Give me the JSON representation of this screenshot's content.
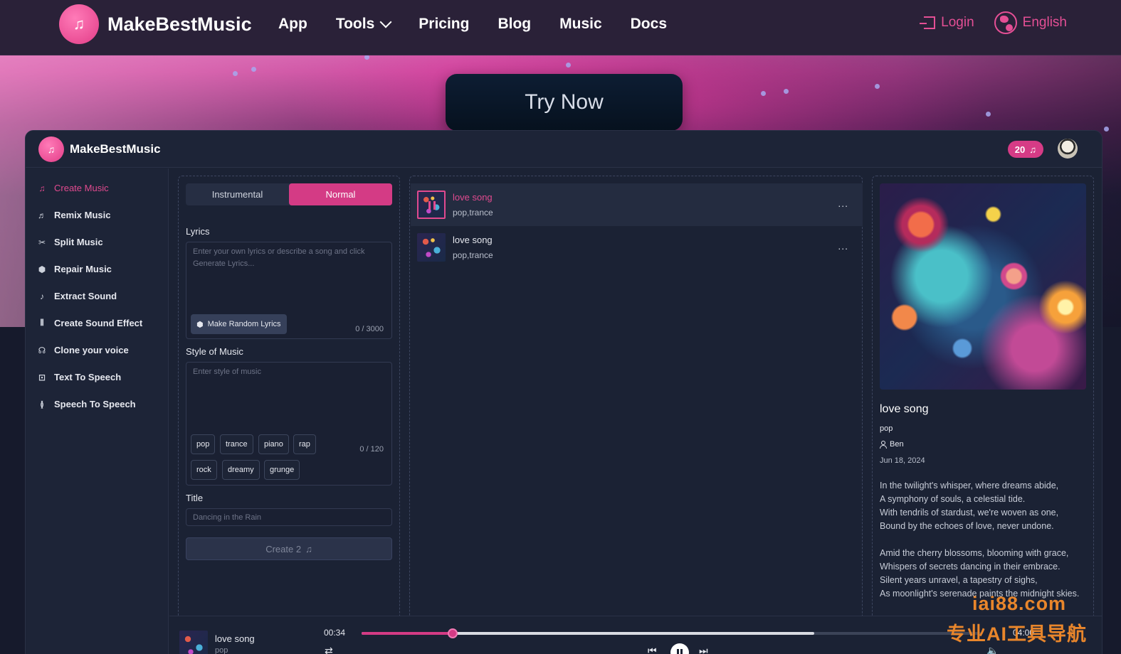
{
  "nav": {
    "brand": "MakeBestMusic",
    "links": [
      "App",
      "Tools",
      "Pricing",
      "Blog",
      "Music",
      "Docs"
    ],
    "login": "Login",
    "language": "English"
  },
  "hero": {
    "cta": "Try Now"
  },
  "app": {
    "title": "MakeBestMusic",
    "credits": "20"
  },
  "sidebar": {
    "items": [
      {
        "label": "Create Music",
        "icon": "music-note-icon"
      },
      {
        "label": "Remix Music",
        "icon": "remix-icon"
      },
      {
        "label": "Split Music",
        "icon": "split-icon"
      },
      {
        "label": "Repair Music",
        "icon": "repair-icon"
      },
      {
        "label": "Extract Sound",
        "icon": "extract-icon"
      },
      {
        "label": "Create Sound Effect",
        "icon": "waveform-icon"
      },
      {
        "label": "Clone your voice",
        "icon": "voice-clone-icon"
      },
      {
        "label": "Text To Speech",
        "icon": "text-scan-icon"
      },
      {
        "label": "Speech To Speech",
        "icon": "speech-icon"
      }
    ]
  },
  "create": {
    "mode_instrumental": "Instrumental",
    "mode_normal": "Normal",
    "lyrics_label": "Lyrics",
    "lyrics_placeholder": "Enter your own lyrics or describe a song and click Generate Lyrics...",
    "random_btn": "Make Random Lyrics",
    "lyrics_counter": "0 / 3000",
    "style_label": "Style of Music",
    "style_placeholder": "Enter style of music",
    "style_counter": "0 / 120",
    "chips": [
      "pop",
      "trance",
      "piano",
      "rap",
      "rock",
      "dreamy",
      "grunge"
    ],
    "title_label": "Title",
    "title_placeholder": "Dancing in the Rain",
    "create_btn": "Create  2"
  },
  "songs": [
    {
      "title": "love song",
      "tags": "pop,trance",
      "more": "...",
      "playing": true
    },
    {
      "title": "love song",
      "tags": "pop,trance",
      "more": "...",
      "playing": false
    }
  ],
  "detail": {
    "title": "love song",
    "genre": "pop",
    "user": "Ben",
    "date": "Jun 18, 2024",
    "stanza1": [
      "In the twilight's whisper, where dreams abide,",
      "A symphony of souls, a celestial tide.",
      "With tendrils of stardust, we're woven as one,",
      "Bound by the echoes of love, never undone."
    ],
    "stanza2": [
      "Amid the cherry blossoms, blooming with grace,",
      "Whispers of secrets dancing in their embrace.",
      "Silent years unravel, a tapestry of sighs,",
      "As moonlight's serenade paints the midnight skies."
    ]
  },
  "player": {
    "title": "love song",
    "sub": "pop",
    "current": "00:34",
    "total": "04:00",
    "progress": 0.147,
    "buffered": 0.731
  },
  "watermark": {
    "line1": "iai88.com",
    "line2": "专业AI工具导航"
  }
}
